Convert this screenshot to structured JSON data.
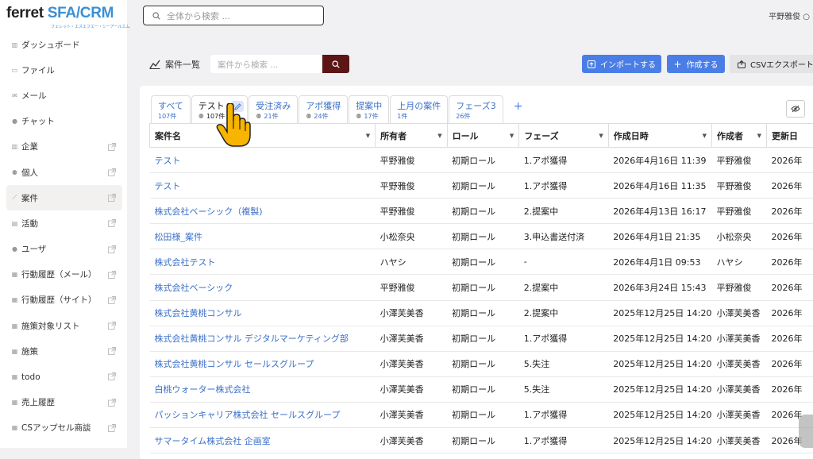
{
  "logo": {
    "main_a": "ferret",
    "main_b": "SFA/CRM",
    "sub": "フェレット・エスエフエー・シーアールエム"
  },
  "search": {
    "placeholder": "全体から検索 ..."
  },
  "user": {
    "name": "平野雅俊"
  },
  "sidebar": {
    "items": [
      {
        "label": "ダッシュボード",
        "icon": "bar-chart-icon",
        "ext": false
      },
      {
        "label": "ファイル",
        "icon": "folder-icon",
        "ext": false
      },
      {
        "label": "メール",
        "icon": "mail-icon",
        "ext": false
      },
      {
        "label": "チャット",
        "icon": "chat-icon",
        "ext": false
      },
      {
        "label": "企業",
        "icon": "bar-chart-icon",
        "ext": true
      },
      {
        "label": "個人",
        "icon": "people-icon",
        "ext": true
      },
      {
        "label": "案件",
        "icon": "line-chart-icon",
        "ext": true
      },
      {
        "label": "活動",
        "icon": "note-icon",
        "ext": true
      },
      {
        "label": "ユーザ",
        "icon": "person-icon",
        "ext": true
      },
      {
        "label": "行動履歴（メール）",
        "icon": "database-icon",
        "ext": true
      },
      {
        "label": "行動履歴（サイト）",
        "icon": "database-icon",
        "ext": true
      },
      {
        "label": "施策対象リスト",
        "icon": "database-icon",
        "ext": true
      },
      {
        "label": "施策",
        "icon": "database-icon",
        "ext": true
      },
      {
        "label": "todo",
        "icon": "database-icon",
        "ext": true
      },
      {
        "label": "売上履歴",
        "icon": "database-icon",
        "ext": true
      },
      {
        "label": "CSアップセル商談",
        "icon": "database-icon",
        "ext": true
      }
    ]
  },
  "page": {
    "title": "案件一覧",
    "search_placeholder": "案件から検索 ...",
    "import_label": "インポートする",
    "create_label": "作成する",
    "csv_label": "CSVエクスポート"
  },
  "tabs": [
    {
      "label": "すべて",
      "count": "107件"
    },
    {
      "label": "テスト",
      "count": "107件"
    },
    {
      "label": "受注済み",
      "count": "21件"
    },
    {
      "label": "アポ獲得",
      "count": "24件"
    },
    {
      "label": "提案中",
      "count": "17件"
    },
    {
      "label": "上月の案件",
      "count": "1件"
    },
    {
      "label": "フェーズ3",
      "count": "26件"
    }
  ],
  "tab_add": "+",
  "table": {
    "columns": [
      "案件名",
      "所有者",
      "ロール",
      "フェーズ",
      "作成日時",
      "作成者",
      "更新日"
    ],
    "rows": [
      [
        "テスト",
        "平野雅俊",
        "初期ロール",
        "1.アポ獲得",
        "2026年4月16日 11:39",
        "平野雅俊",
        "2026年"
      ],
      [
        "テスト",
        "平野雅俊",
        "初期ロール",
        "1.アポ獲得",
        "2026年4月16日 11:35",
        "平野雅俊",
        "2026年"
      ],
      [
        "株式会社ベーシック（複製)",
        "平野雅俊",
        "初期ロール",
        "2.提案中",
        "2026年4月13日 16:17",
        "平野雅俊",
        "2026年"
      ],
      [
        "松田様_案件",
        "小松奈央",
        "初期ロール",
        "3.申込書送付済",
        "2026年4月1日 21:35",
        "小松奈央",
        "2026年"
      ],
      [
        "株式会社テスト",
        "ハヤシ",
        "初期ロール",
        "-",
        "2026年4月1日 09:53",
        "ハヤシ",
        "2026年"
      ],
      [
        "株式会社ベーシック",
        "平野雅俊",
        "初期ロール",
        "2.提案中",
        "2026年3月24日 15:43",
        "平野雅俊",
        "2026年"
      ],
      [
        "株式会社黄桃コンサル",
        "小澤芙美香",
        "初期ロール",
        "2.提案中",
        "2025年12月25日 14:20",
        "小澤芙美香",
        "2026年"
      ],
      [
        "株式会社黄桃コンサル デジタルマーケティング部",
        "小澤芙美香",
        "初期ロール",
        "1.アポ獲得",
        "2025年12月25日 14:20",
        "小澤芙美香",
        "2026年"
      ],
      [
        "株式会社黄桃コンサル セールスグループ",
        "小澤芙美香",
        "初期ロール",
        "5.失注",
        "2025年12月25日 14:20",
        "小澤芙美香",
        "2026年"
      ],
      [
        "白桃ウォーター株式会社",
        "小澤芙美香",
        "初期ロール",
        "5.失注",
        "2025年12月25日 14:20",
        "小澤芙美香",
        "2026年"
      ],
      [
        "パッションキャリア株式会社 セールスグループ",
        "小澤芙美香",
        "初期ロール",
        "1.アポ獲得",
        "2025年12月25日 14:20",
        "小澤芙美香",
        "2026年"
      ],
      [
        "サマータイム株式会社 企画室",
        "小澤芙美香",
        "初期ロール",
        "1.アポ獲得",
        "2025年12月25日 14:20",
        "小澤芙美香",
        "2026年"
      ]
    ]
  },
  "colors": {
    "accent": "#4a7ee6",
    "link": "#3b6fc7",
    "search_button": "#5c1616",
    "brand": "#3b8fd6"
  }
}
